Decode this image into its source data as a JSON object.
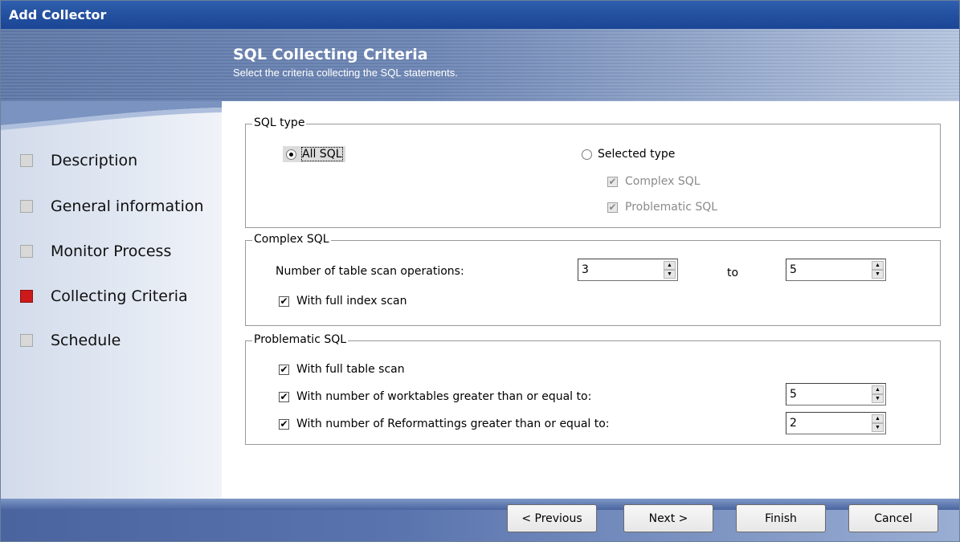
{
  "window": {
    "title": "Add Collector"
  },
  "header": {
    "title": "SQL Collecting Criteria",
    "subtitle": "Select the criteria collecting the SQL statements."
  },
  "sidebar": {
    "items": [
      {
        "label": "Description",
        "state": "inactive",
        "color": "#d8d8d8"
      },
      {
        "label": "General information",
        "state": "inactive",
        "color": "#d8d8d8"
      },
      {
        "label": "Monitor Process",
        "state": "inactive",
        "color": "#d8d8d8"
      },
      {
        "label": "Collecting Criteria",
        "state": "active",
        "color": "#cc1a1a"
      },
      {
        "label": "Schedule",
        "state": "inactive",
        "color": "#d8d8d8"
      }
    ]
  },
  "sql_type": {
    "legend": "SQL type",
    "all_sql": {
      "label": "All SQL",
      "selected": true
    },
    "selected_type": {
      "label": "Selected type",
      "selected": false
    },
    "complex_sql": {
      "label": "Complex SQL",
      "checked": true,
      "enabled": false
    },
    "problematic_sql": {
      "label": "Problematic SQL",
      "checked": true,
      "enabled": false
    }
  },
  "complex_sql": {
    "legend": "Complex SQL",
    "table_scan_label": "Number of table scan operations:",
    "from_value": "3",
    "to_label": "to",
    "to_value": "5",
    "full_index_scan": {
      "label": "With full index scan",
      "checked": true
    }
  },
  "problematic_sql": {
    "legend": "Problematic SQL",
    "full_table_scan": {
      "label": "With full table scan",
      "checked": true
    },
    "worktables": {
      "label": "With number of worktables greater than or equal to:",
      "checked": true,
      "value": "5"
    },
    "reformattings": {
      "label": "With number of Reformattings greater than or equal to:",
      "checked": true,
      "value": "2"
    }
  },
  "buttons": {
    "previous": "< Previous",
    "next": "Next >",
    "finish": "Finish",
    "cancel": "Cancel"
  },
  "icons": {
    "checkmark": "✔",
    "spin_up": "▲",
    "spin_down": "▼"
  }
}
